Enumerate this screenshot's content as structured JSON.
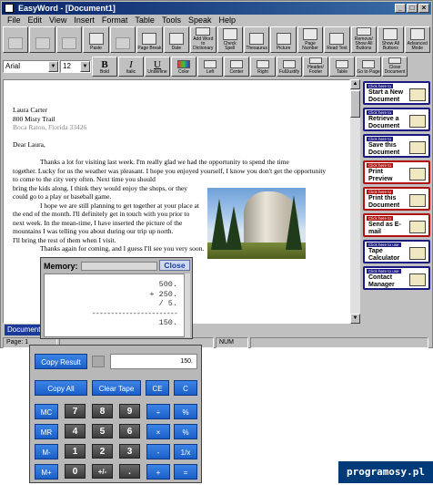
{
  "window": {
    "title": "EasyWord - [Document1]",
    "controls": [
      "_",
      "□",
      "×"
    ]
  },
  "menu": [
    "File",
    "Edit",
    "View",
    "Insert",
    "Format",
    "Table",
    "Tools",
    "Speak",
    "Help"
  ],
  "toolbar1": [
    {
      "label": "",
      "disabled": true
    },
    {
      "label": "",
      "disabled": true
    },
    {
      "label": "",
      "disabled": true
    },
    {
      "label": "Paste",
      "disabled": false
    },
    {
      "label": "",
      "disabled": true
    },
    {
      "label": "Page Break",
      "disabled": false
    },
    {
      "label": "Date",
      "disabled": false
    },
    {
      "label": "Add Word to Dictionary",
      "disabled": false
    },
    {
      "label": "Check Spell",
      "disabled": false
    },
    {
      "label": "Thesaurus",
      "disabled": false
    },
    {
      "label": "Picture",
      "disabled": false
    },
    {
      "label": "Page Number",
      "disabled": false
    },
    {
      "label": "Read Text",
      "disabled": false
    },
    {
      "label": "Remove/ Show All Buttons",
      "disabled": false
    },
    {
      "label": "Show All Buttons",
      "disabled": false
    },
    {
      "label": "Advanced Mode",
      "disabled": false
    }
  ],
  "toolbar2": {
    "font": "Arial",
    "size": "12",
    "buttons": [
      "Bold",
      "Italic",
      "Underline",
      "Color",
      "Left",
      "Center",
      "Right",
      "FullJustify",
      "Header/ Footer",
      "Table",
      "Go to Page",
      "Close Document"
    ]
  },
  "letter": {
    "addr_name": "Laura Carter",
    "addr_street": "800 Misty Trail",
    "addr_city": "Boca Raton, Florida 33426",
    "salutation": "Dear Laura,",
    "para1_l1": "Thanks a lot for visiting last week. I'm really glad we had the opportunity to spend the time",
    "para1_l2": "together.  Lucky for us the weather was pleasant.  I hope you enjoyed yourself, I know you don't get the opportunity",
    "para1_l3": "to come to the city very often.   Next time  you  should",
    "para1_l4": "bring the kids along.  I think they would enjoy the shops, or they",
    "para1_l5": "could go to a play or baseball game.",
    "para2_l1": "I hope we are still planning to get together at your place at",
    "para2_l2": "the end of the month.  I'll definitely get  in touch  with you  prior to",
    "para2_l3": "next week.   In  the  mean-time,  I have inserted  the picture  of  the",
    "para2_l4": "mountains  I  was  telling  you  about  during  our  trip  up  north.",
    "para2_l5": "I'll bring the rest of them when I visit.",
    "para3_l1": "Thanks again for coming, and I guess I'll see you very soon."
  },
  "sidebar": [
    {
      "top": "Click here to",
      "label": "Start a New Document",
      "accent": "#1a1a80"
    },
    {
      "top": "Click here to",
      "label": "Retrieve a Document",
      "accent": "#1a1a80"
    },
    {
      "top": "Click here to",
      "label": "Save this Document",
      "accent": "#1a1a80"
    },
    {
      "top": "Click here to",
      "label": "Print Preview",
      "accent": "#b01010"
    },
    {
      "top": "Click here to",
      "label": "Print this Document",
      "accent": "#b01010"
    },
    {
      "top": "Click here to",
      "label": "Send as E-mail",
      "accent": "#b01010"
    },
    {
      "top": "Click here to use",
      "label": "Tape Calculator",
      "accent": "#1a1a80"
    },
    {
      "top": "Click here to use",
      "label": "Contact Manager",
      "accent": "#1a1a80"
    }
  ],
  "tab": "Document1",
  "status": {
    "page": "Page: 1",
    "num": "NUM"
  },
  "memory": {
    "label": "Memory:",
    "close": "Close",
    "tape": [
      "500.",
      "+ 250.",
      "/ 5.",
      "-----------------------",
      "150."
    ]
  },
  "calculator": {
    "copy_result": "Copy Result",
    "display": "150.",
    "copy_all": "Copy All",
    "clear_tape": "Clear Tape",
    "ce": "CE",
    "c": "C",
    "keys": [
      [
        "MC",
        "7",
        "8",
        "9",
        "÷",
        "%"
      ],
      [
        "MR",
        "4",
        "5",
        "6",
        "×",
        "%"
      ],
      [
        "M-",
        "1",
        "2",
        "3",
        "-",
        "1/x"
      ],
      [
        "M+",
        "0",
        "+/-",
        ".",
        "+",
        "="
      ]
    ]
  },
  "watermark": "programosy.pl"
}
